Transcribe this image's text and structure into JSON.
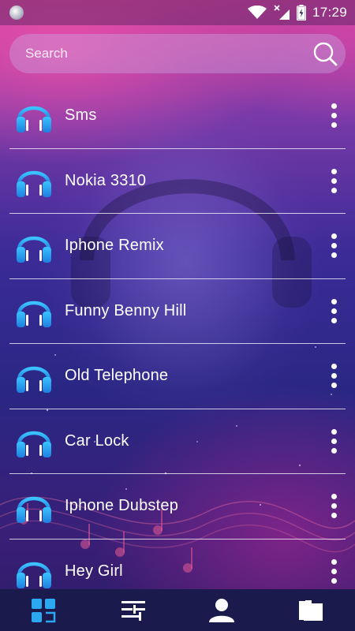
{
  "status": {
    "time": "17:29"
  },
  "search": {
    "placeholder": "Search"
  },
  "ringtones": [
    {
      "name": "Sms"
    },
    {
      "name": "Nokia 3310"
    },
    {
      "name": "Iphone Remix"
    },
    {
      "name": "Funny Benny Hill"
    },
    {
      "name": "Old Telephone"
    },
    {
      "name": "Car Lock"
    },
    {
      "name": "Iphone Dubstep"
    },
    {
      "name": "Hey Girl"
    }
  ],
  "nav": [
    {
      "icon": "categories-icon",
      "active": true
    },
    {
      "icon": "sliders-icon",
      "active": false
    },
    {
      "icon": "contact-icon",
      "active": false
    },
    {
      "icon": "folder-icon",
      "active": false
    }
  ],
  "colors": {
    "accent": "#2aa8f0",
    "nav_bg": "#1b1a4c"
  }
}
